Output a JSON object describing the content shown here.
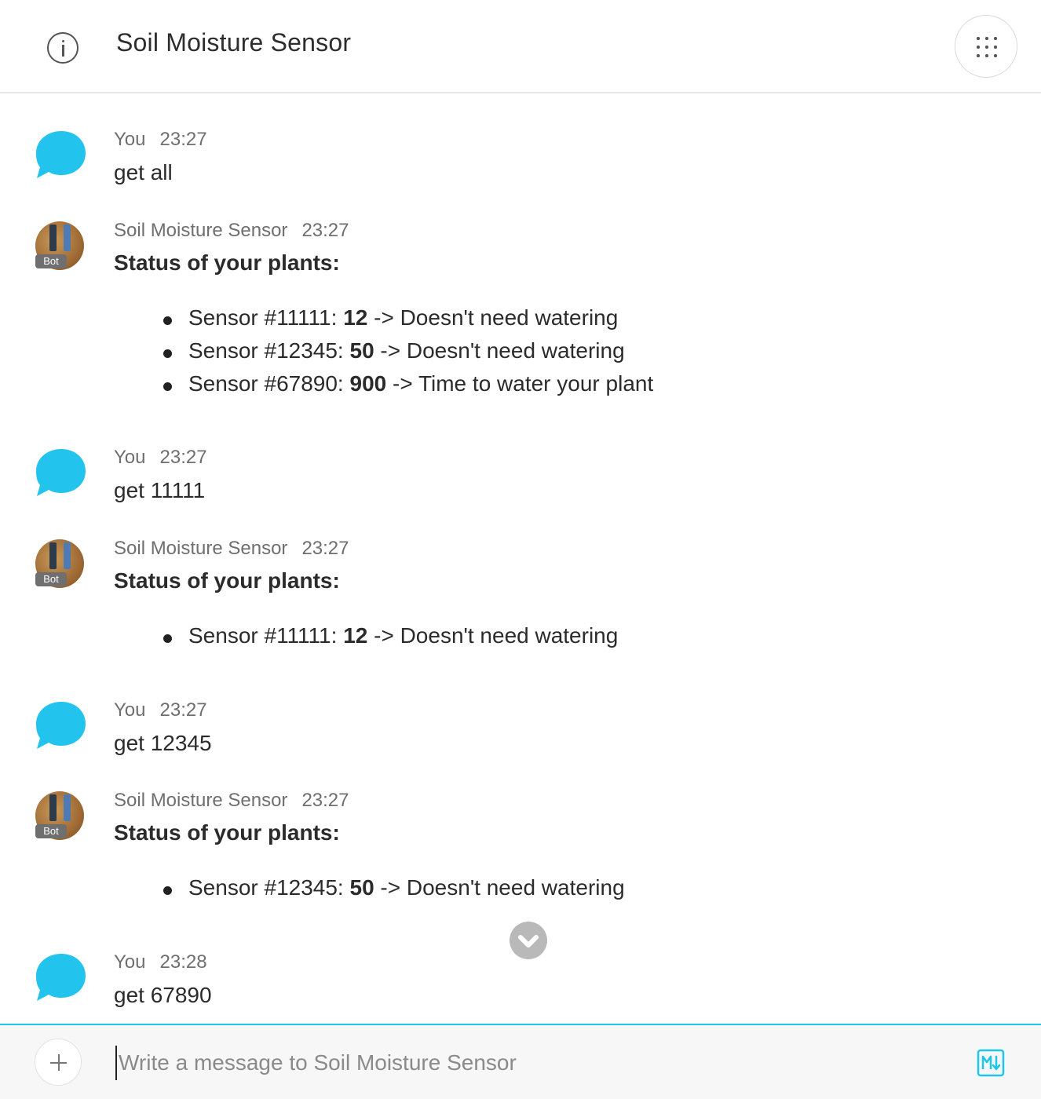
{
  "header": {
    "title": "Soil Moisture Sensor"
  },
  "messages": [
    {
      "author": "You",
      "time": "23:27",
      "text": "get all"
    },
    {
      "author": "Soil Moisture Sensor",
      "badge": "Bot",
      "time": "23:27",
      "heading": "Status of your plants:",
      "items": [
        {
          "prefix": "Sensor #11111: ",
          "value": "12",
          "suffix": " -> Doesn't need watering"
        },
        {
          "prefix": "Sensor #12345: ",
          "value": "50",
          "suffix": " -> Doesn't need watering"
        },
        {
          "prefix": "Sensor #67890: ",
          "value": "900",
          "suffix": " -> Time to water your plant"
        }
      ]
    },
    {
      "author": "You",
      "time": "23:27",
      "text": "get 11111"
    },
    {
      "author": "Soil Moisture Sensor",
      "badge": "Bot",
      "time": "23:27",
      "heading": "Status of your plants:",
      "items": [
        {
          "prefix": "Sensor #11111: ",
          "value": "12",
          "suffix": " -> Doesn't need watering"
        }
      ]
    },
    {
      "author": "You",
      "time": "23:27",
      "text": "get 12345"
    },
    {
      "author": "Soil Moisture Sensor",
      "badge": "Bot",
      "time": "23:27",
      "heading": "Status of your plants:",
      "items": [
        {
          "prefix": "Sensor #12345: ",
          "value": "50",
          "suffix": " -> Doesn't need watering"
        }
      ]
    },
    {
      "author": "You",
      "time": "23:28",
      "text": "get 67890"
    }
  ],
  "composer": {
    "placeholder": "Write a message to Soil Moisture Sensor"
  },
  "icons": {
    "info": "info-icon",
    "apps": "apps-grid-icon",
    "user_avatar": "chat-bubble-icon",
    "scroll": "chevron-down-icon",
    "add": "plus-icon",
    "markdown": "markdown-icon"
  },
  "colors": {
    "accent": "#1ec6ea",
    "user_bubble": "#22c4ee",
    "muted_text": "#6f6f6f"
  }
}
